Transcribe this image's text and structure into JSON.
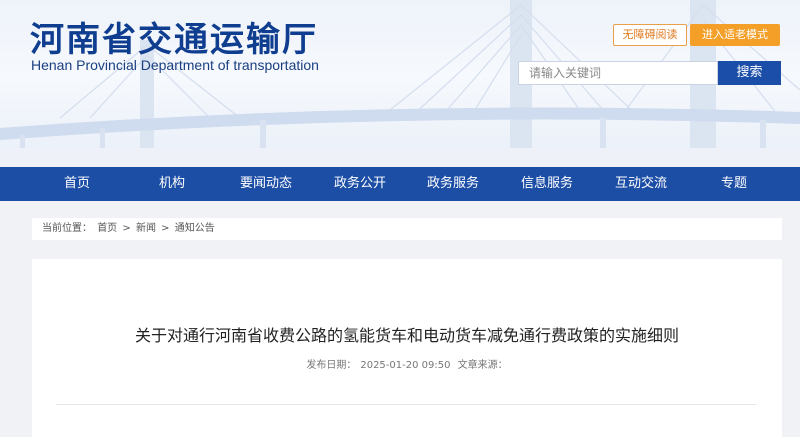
{
  "header": {
    "title": "河南省交通运输厅",
    "subtitle": "Henan Provincial Department of transportation",
    "accessibility_label": "无障碍阅读",
    "elder_mode_label": "进入适老模式"
  },
  "search": {
    "placeholder": "请输入关键词",
    "button_label": "搜索"
  },
  "nav": {
    "items": [
      "首页",
      "机构",
      "要闻动态",
      "政务公开",
      "政务服务",
      "信息服务",
      "互动交流",
      "专题"
    ]
  },
  "breadcrumb": {
    "prefix": "当前位置：",
    "home": "首页",
    "sep1": ">",
    "news": "新闻",
    "sep2": ">",
    "notices": "通知公告"
  },
  "article": {
    "title": "关于对通行河南省收费公路的氢能货车和电动货车减免通行费政策的实施细则",
    "date_label": "发布日期：",
    "date_value": "2025-01-20 09:50",
    "source_label": "文章来源："
  },
  "colors": {
    "brand_blue": "#1c4ea6",
    "title_blue": "#0f3d8f",
    "accent_orange": "#f39f28"
  }
}
